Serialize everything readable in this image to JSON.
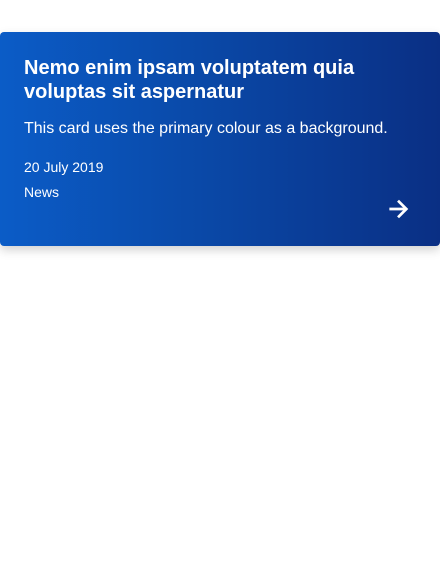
{
  "card": {
    "title": "Nemo enim ipsam voluptatem quia voluptas sit aspernatur",
    "description": "This card uses the primary colour as a background.",
    "date": "20 July 2019",
    "tag": "News",
    "arrow_icon": "arrow-right-icon",
    "background_colors": [
      "#0b5cc7",
      "#0a2f84"
    ],
    "text_color": "#ffffff"
  }
}
